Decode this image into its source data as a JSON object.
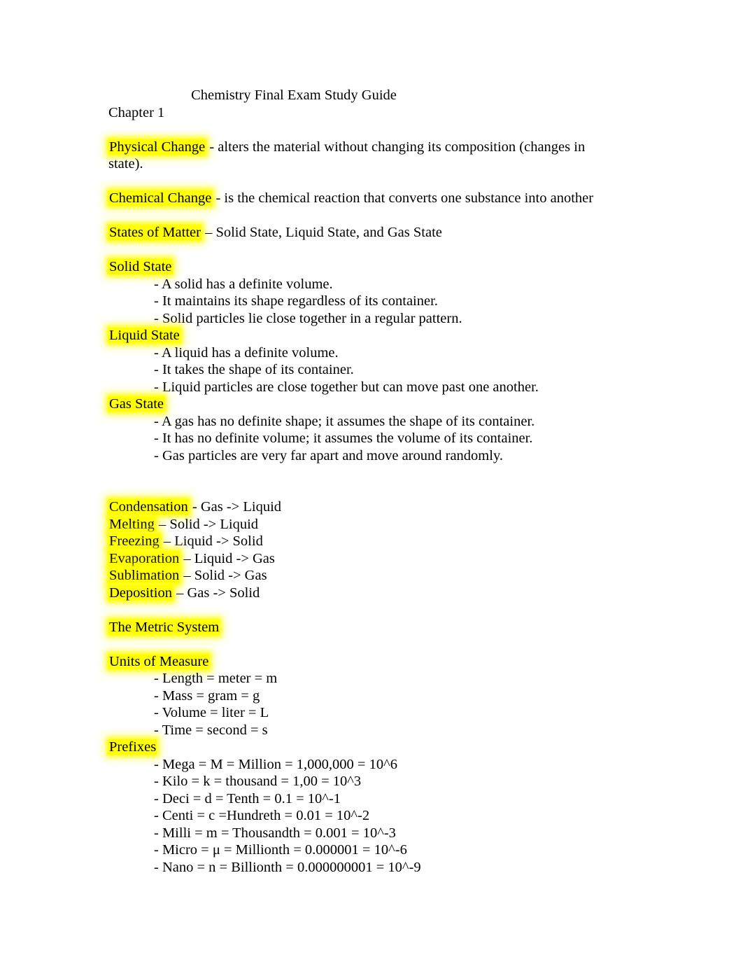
{
  "document": {
    "title": "Chemistry Final Exam Study Guide",
    "chapter": "Chapter 1",
    "definitions": {
      "physical_change_term": "Physical Change",
      "physical_change_body": " - alters the material without changing its composition (changes in state).",
      "chemical_change_term": "Chemical Change",
      "chemical_change_body": " - is the chemical reaction that converts one substance into another",
      "states_of_matter_term": "States of Matter",
      "states_of_matter_body": " – Solid State, Liquid State, and Gas State"
    },
    "states": [
      {
        "heading": "Solid State",
        "points": [
          "- A solid has a definite volume.",
          "- It maintains its shape regardless of its container.",
          "- Solid particles lie close together in a regular pattern."
        ]
      },
      {
        "heading": "Liquid State",
        "points": [
          "- A liquid has a definite volume.",
          "- It takes the shape of its container.",
          "- Liquid particles are close together but can move past one another."
        ]
      },
      {
        "heading": "Gas State",
        "points": [
          "- A gas has no definite shape; it assumes the shape of its container.",
          "- It has no definite volume; it assumes the volume of its container.",
          "- Gas particles are very far apart and move around randomly."
        ]
      }
    ],
    "phase_changes": [
      {
        "term": "Condensation",
        "body": " - Gas -> Liquid"
      },
      {
        "term": "Melting",
        "body": " – Solid -> Liquid"
      },
      {
        "term": "Freezing",
        "body": " – Liquid -> Solid"
      },
      {
        "term": "Evaporation",
        "body": " – Liquid -> Gas"
      },
      {
        "term": "Sublimation",
        "body": " – Solid -> Gas"
      },
      {
        "term": "Deposition",
        "body": " – Gas -> Solid"
      }
    ],
    "metric_system": {
      "heading": "The Metric System",
      "units_heading": "Units of Measure",
      "units": [
        "- Length = meter = m",
        "- Mass = gram = g",
        "- Volume = liter = L",
        "- Time = second = s"
      ],
      "prefixes_heading": "Prefixes",
      "prefixes": [
        "- Mega = M = Million = 1,000,000 = 10^6",
        "- Kilo = k = thousand = 1,00 = 10^3",
        "- Deci = d = Tenth = 0.1 = 10^-1",
        "- Centi = c =Hundreth = 0.01 = 10^-2",
        "- Milli = m = Thousandth = 0.001 = 10^-3",
        "- Micro = μ = Millionth = 0.000001 = 10^-6",
        "- Nano = n = Billionth = 0.000000001 = 10^-9"
      ]
    }
  },
  "style": {
    "highlight_color": "#FFFF00",
    "text_color": "#000000",
    "page_background": "#FFFFFF"
  }
}
